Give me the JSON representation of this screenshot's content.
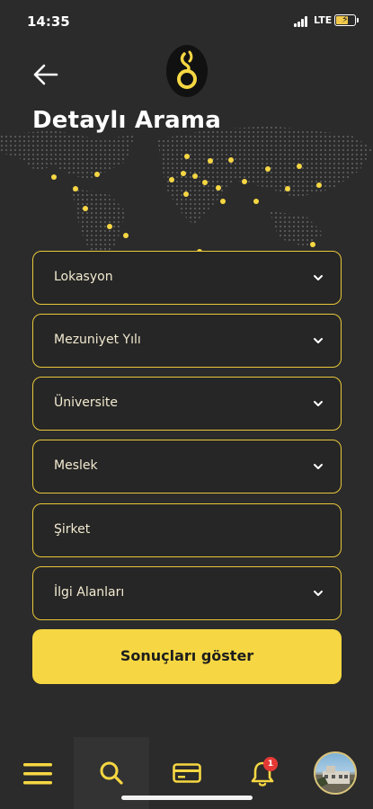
{
  "status_bar": {
    "time": "14:35",
    "network": "LTE"
  },
  "page": {
    "title": "Detaylı Arama"
  },
  "filters": [
    {
      "label": "Lokasyon",
      "has_dropdown": true
    },
    {
      "label": "Mezuniyet Yılı",
      "has_dropdown": true
    },
    {
      "label": "Üniversite",
      "has_dropdown": true
    },
    {
      "label": "Meslek",
      "has_dropdown": true
    },
    {
      "label": "Şirket",
      "has_dropdown": false
    },
    {
      "label": "İlgi Alanları",
      "has_dropdown": true
    }
  ],
  "submit": {
    "label": "Sonuçları göster"
  },
  "tabbar": {
    "items": [
      "menu-icon",
      "search-icon",
      "card-icon",
      "bell-icon",
      "avatar"
    ],
    "active": "search-icon",
    "notification_count": "1"
  },
  "colors": {
    "accent": "#f6d743",
    "background": "#2b2b2b",
    "border": "#e9c73a"
  }
}
